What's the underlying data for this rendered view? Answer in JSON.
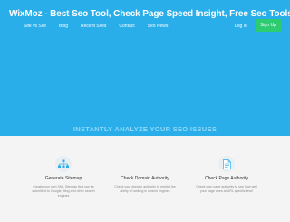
{
  "header": {
    "logo_text": "WixMoz - Best Seo Tool, Check Page Speed Insight, Free Seo Tools",
    "nav": [
      "Site vs Site",
      "Blog",
      "Recent Sites",
      "Contact",
      "Seo News"
    ],
    "login_label": "Log in",
    "signup_label": "Sign Up"
  },
  "hero": {
    "tagline": "INSTANTLY ANALYZE YOUR SEO ISSUES"
  },
  "features": [
    {
      "title": "Generate Sitemap",
      "description": "Create your own XML Sitemap that can be submitted to Google, Bing and other search engines",
      "icon": "sitemap-icon"
    },
    {
      "title": "Check Domain Authority",
      "description": "Check your domain authority to predict the ability of ranking in search engines",
      "icon": ""
    },
    {
      "title": "Check Page Authority",
      "description": "Check your page authority to see how well your page does at URL specific level",
      "icon": "document-icon"
    }
  ],
  "colors": {
    "hero_bg": "#2aaeea",
    "signup_bg": "#2ecc71",
    "page_bg": "#f4f4f4"
  }
}
